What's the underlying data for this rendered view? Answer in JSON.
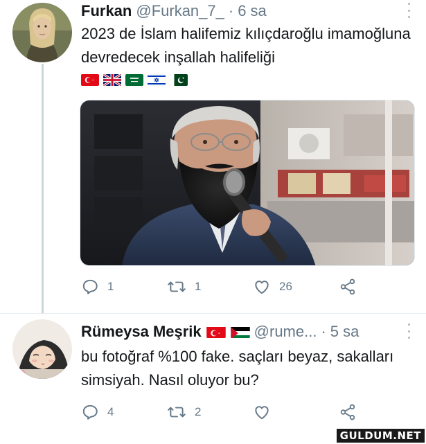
{
  "tweets": [
    {
      "name": "Furkan",
      "handle": "@Furkan_7_",
      "separator": "·",
      "time": "6 sa",
      "text": "2023 de İslam halifemiz kılıçdaroğlu imamoğluna devredecek inşallah halifeliği",
      "flags": [
        "turkey-flag",
        "uk-flag",
        "saudi-flag",
        "israel-flag",
        "pakistan-flag"
      ],
      "actions": {
        "reply_count": "1",
        "retweet_count": "1",
        "like_count": "26"
      }
    },
    {
      "name": "Rümeysa Meşrik",
      "name_flags": [
        "turkey-flag",
        "palestine-flag"
      ],
      "handle": "@rume...",
      "separator": "·",
      "time": "5 sa",
      "text": "bu fotoğraf %100 fake. saçları beyaz, sakalları simsiyah. Nasıl oluyor bu?",
      "actions": {
        "reply_count": "4",
        "retweet_count": "2",
        "like_count": ""
      }
    }
  ],
  "watermark": "GULDUM.NET",
  "colors": {
    "text": "#14171a",
    "secondary": "#657786",
    "thread_line": "#ccd6dd"
  }
}
